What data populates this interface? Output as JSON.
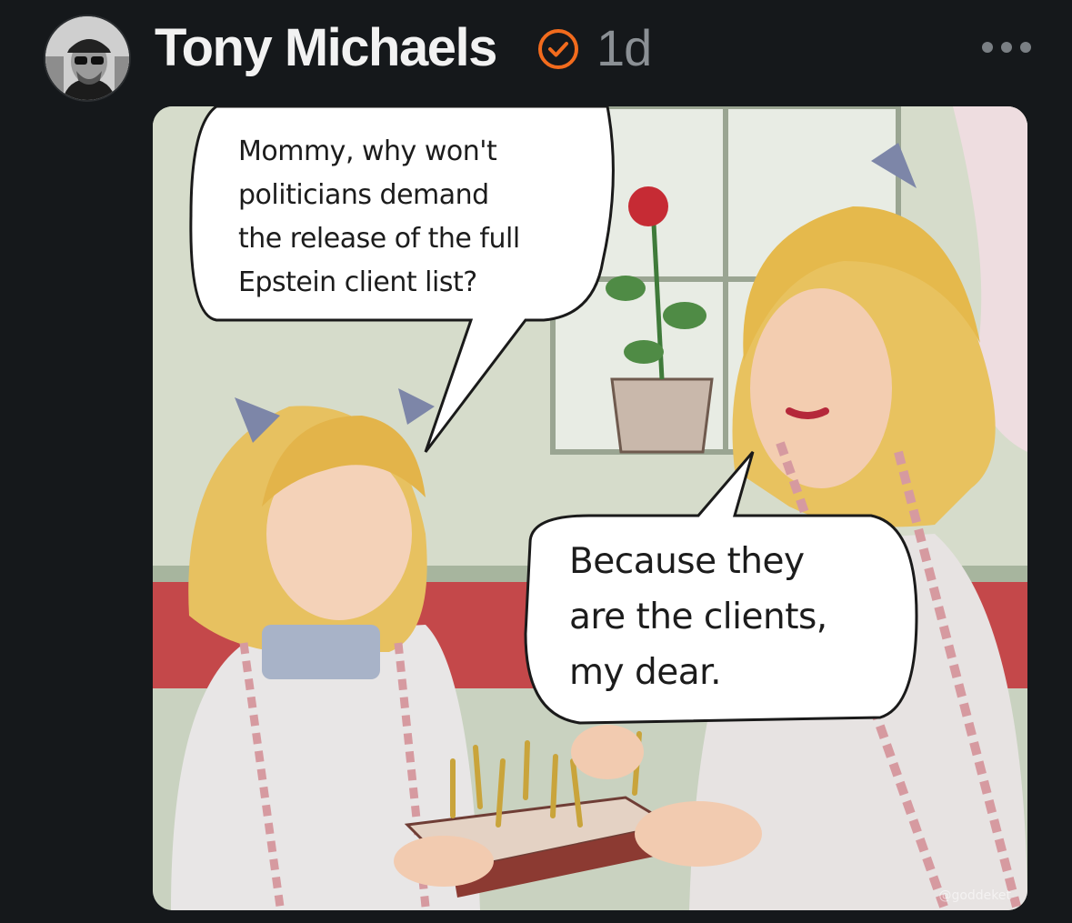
{
  "post": {
    "author_name": "Tony Michaels",
    "timestamp": "1d",
    "verified_icon": "verified-check-icon",
    "more_icon": "more-options-icon",
    "accent_color": "#f26b1d"
  },
  "media": {
    "bubble_1": "Mommy, why won't\npoliticians demand\nthe release of the full\nEpstein client list?",
    "bubble_2": "Because they\nare the clients,\nmy dear.",
    "watermark": "@goddeket"
  }
}
